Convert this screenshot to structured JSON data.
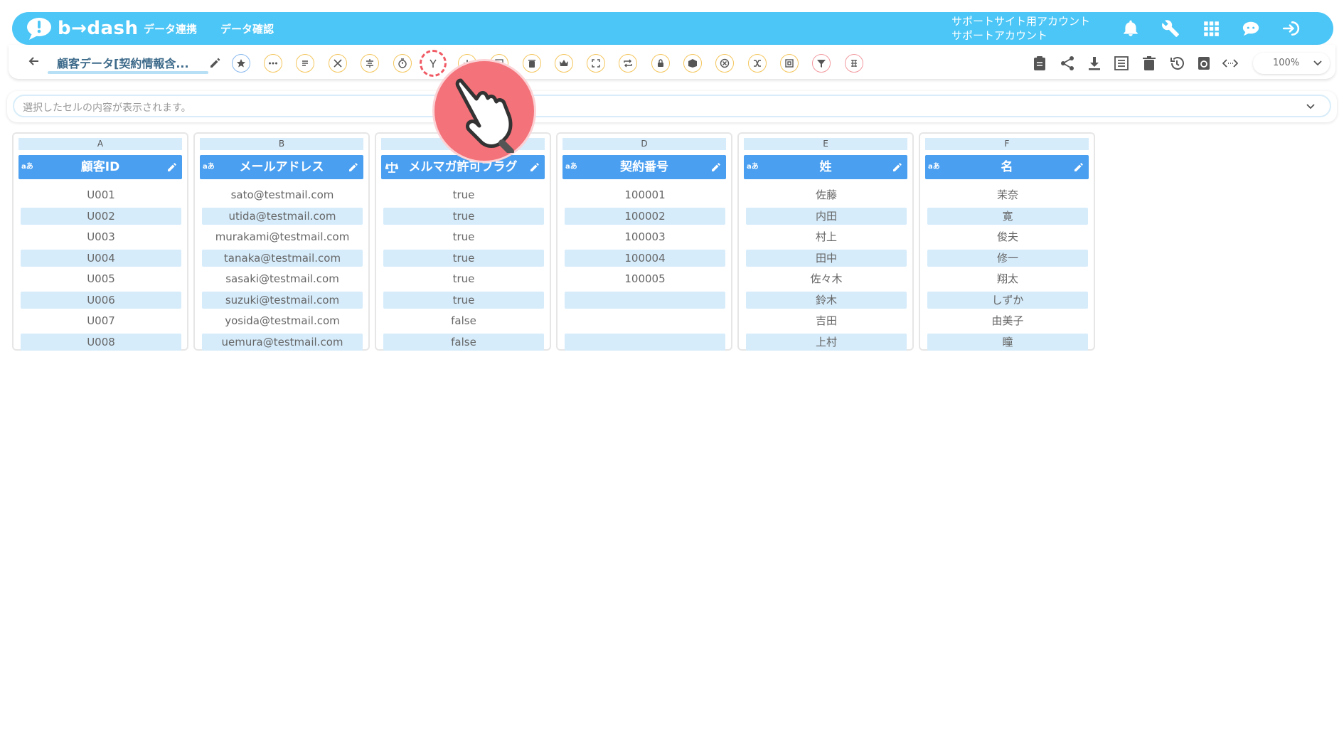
{
  "topbar": {
    "logo_text": "b→dash",
    "nav": [
      "データ連携",
      "データ確認"
    ],
    "account_line1": "サポートサイト用アカウント",
    "account_line2": "サポートアカウント",
    "icons": [
      "bell-icon",
      "wrench-icon",
      "grid-icon",
      "chat-icon",
      "logout-icon"
    ]
  },
  "toolbar": {
    "title": "顧客データ[契約情報含...",
    "zoom": "100%",
    "left_icons": [
      "star-icon",
      "more-icon",
      "lines-icon",
      "tools-icon",
      "compress-icon",
      "timer-icon",
      "fork-icon",
      "plus-icon",
      "calc-icon",
      "trash-icon",
      "crown-icon",
      "expand-icon",
      "repeat-icon",
      "lock-icon",
      "box-icon",
      "cancel-icon",
      "shuffle-icon",
      "square-icon",
      "filter-icon",
      "pattern-icon"
    ],
    "right_icons": [
      "clipboard-icon",
      "share-icon",
      "download-icon",
      "list-icon",
      "delete-icon",
      "history-icon",
      "refresh-icon",
      "code-icon"
    ]
  },
  "cellbar": {
    "placeholder": "選択したセルの内容が表示されます。"
  },
  "columns": [
    {
      "letter": "A",
      "type": "aあ",
      "name": "顧客ID",
      "cells": [
        "U001",
        "U002",
        "U003",
        "U004",
        "U005",
        "U006",
        "U007",
        "U008"
      ]
    },
    {
      "letter": "B",
      "type": "aあ",
      "name": "メールアドレス",
      "cells": [
        "sato@testmail.com",
        "utida@testmail.com",
        "murakami@testmail.com",
        "tanaka@testmail.com",
        "sasaki@testmail.com",
        "suzuki@testmail.com",
        "yosida@testmail.com",
        "uemura@testmail.com"
      ]
    },
    {
      "letter": "C",
      "type": "scale-icon",
      "name": "メルマガ許可フラグ",
      "cells": [
        "true",
        "true",
        "true",
        "true",
        "true",
        "true",
        "false",
        "false"
      ]
    },
    {
      "letter": "D",
      "type": "aあ",
      "name": "契約番号",
      "cells": [
        "100001",
        "100002",
        "100003",
        "100004",
        "100005",
        "",
        "",
        ""
      ]
    },
    {
      "letter": "E",
      "type": "aあ",
      "name": "姓",
      "cells": [
        "佐藤",
        "内田",
        "村上",
        "田中",
        "佐々木",
        "鈴木",
        "吉田",
        "上村"
      ]
    },
    {
      "letter": "F",
      "type": "aあ",
      "name": "名",
      "cells": [
        "茉奈",
        "寛",
        "俊夫",
        "修一",
        "翔太",
        "しずか",
        "由美子",
        "瞳"
      ]
    }
  ],
  "colors": {
    "topbar": "#4cc6f6",
    "header": "#4a9ff0",
    "alt_row": "#d6ecfb",
    "tap": "#f4727a"
  }
}
